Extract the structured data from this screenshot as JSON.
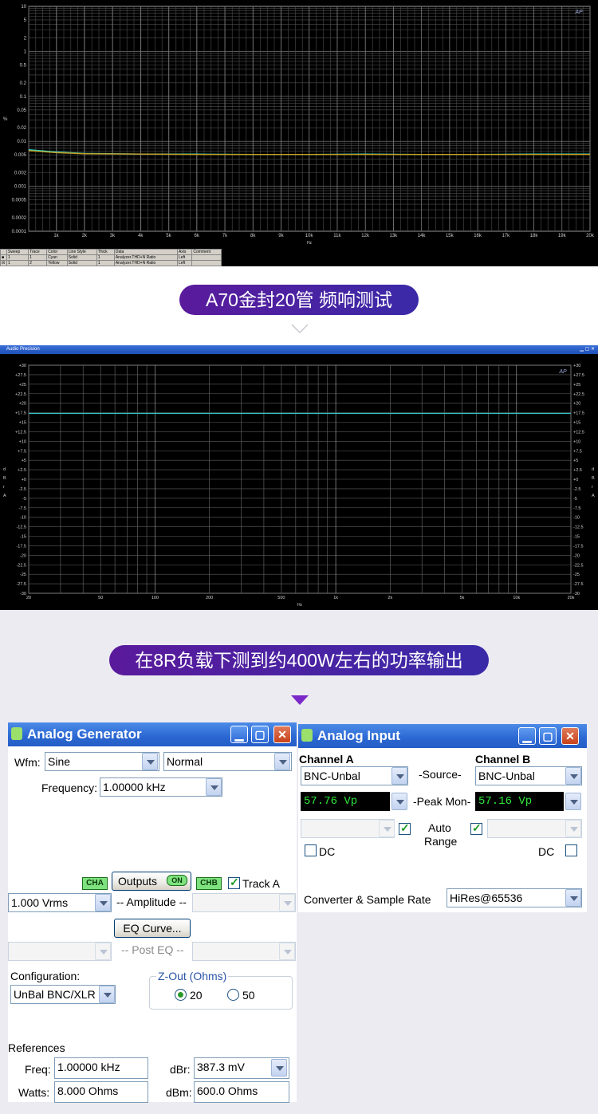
{
  "thd_chart": {
    "y_ticks": [
      "10",
      "5",
      "2",
      "1",
      "0.5",
      "0.2",
      "0.1",
      "0.05",
      "0.02",
      "0.01",
      "0.005",
      "0.002",
      "0.001",
      "0.0005",
      "0.0002",
      "0.0001"
    ],
    "x_ticks": [
      "1k",
      "2k",
      "3k",
      "4k",
      "5k",
      "6k",
      "7k",
      "8k",
      "9k",
      "10k",
      "11k",
      "12k",
      "13k",
      "14k",
      "15k",
      "16k",
      "17k",
      "18k",
      "19k",
      "20k"
    ],
    "ylabel": "%",
    "xlabel": "Hz",
    "logo": "AP",
    "table_headers": [
      "Sweep",
      "Trace",
      "Color",
      "Line Style",
      "Thick",
      "Data",
      "Axis",
      "Comment"
    ],
    "table_rows": [
      [
        "1",
        "1",
        "Cyan",
        "Solid",
        "1",
        "Analyzer.THD+N Ratio",
        "Left",
        ""
      ],
      [
        "1",
        "2",
        "Yellow",
        "Solid",
        "1",
        "Analyzer.THD+N Ratio",
        "Left",
        ""
      ]
    ]
  },
  "chart_data": [
    {
      "type": "line",
      "ylabel": "%",
      "xlabel": "Hz",
      "x": [
        20,
        1000,
        2000,
        4000,
        6000,
        8000,
        10000,
        12000,
        14000,
        16000,
        18000,
        20000
      ],
      "xlim": [
        20,
        20000
      ],
      "ylim": [
        0.0001,
        10
      ],
      "yscale": "log",
      "series": [
        {
          "name": "Cyan",
          "color": "#2fd0c0",
          "values": [
            0.0065,
            0.0058,
            0.0054,
            0.0052,
            0.0052,
            0.0051,
            0.0051,
            0.0052,
            0.0051,
            0.0051,
            0.0052,
            0.0052
          ]
        },
        {
          "name": "Yellow",
          "color": "#c8a020",
          "values": [
            0.0062,
            0.0056,
            0.0053,
            0.0052,
            0.0051,
            0.0051,
            0.0051,
            0.0051,
            0.0051,
            0.0051,
            0.0051,
            0.0051
          ]
        }
      ]
    },
    {
      "type": "line",
      "xlabel": "Hz",
      "ylabel": "dBrA",
      "x": [
        20,
        50,
        100,
        200,
        500,
        1000,
        2000,
        5000,
        10000,
        20000
      ],
      "xscale": "log",
      "xlim": [
        20,
        20000
      ],
      "ylim": [
        -30,
        30
      ],
      "series": [
        {
          "name": "Cyan",
          "color": "#2fc0c0",
          "values": [
            17.3,
            17.3,
            17.3,
            17.3,
            17.3,
            17.3,
            17.3,
            17.3,
            17.3,
            17.3
          ]
        }
      ]
    }
  ],
  "titles": {
    "t1": "A70金封20管  频响测试",
    "t2": "在8R负载下测到约400W左右的功率输出"
  },
  "fr_chart": {
    "window_title": "Audio Precision",
    "y_ticks": [
      "+30",
      "+27.5",
      "+25",
      "+22.5",
      "+20",
      "+17.5",
      "+15",
      "+12.5",
      "+10",
      "+7.5",
      "+5",
      "+2.5",
      "+0",
      "-2.5",
      "-5",
      "-7.5",
      "-10",
      "-12.5",
      "-15",
      "-17.5",
      "-20",
      "-22.5",
      "-25",
      "-27.5",
      "-30"
    ],
    "x_ticks": [
      "20",
      "50",
      "100",
      "200",
      "500",
      "1k",
      "2k",
      "5k",
      "10k",
      "20k"
    ],
    "ylabel_left": [
      "d",
      "B",
      "r",
      "A"
    ],
    "ylabel_right": [
      "d",
      "B",
      "r",
      "A"
    ],
    "xlabel": "Hz",
    "logo": "AP"
  },
  "generator": {
    "title": "Analog Generator",
    "wfm_label": "Wfm:",
    "wfm_value": "Sine",
    "wfm_mode": "Normal",
    "freq_label": "Frequency:",
    "freq_value": "1.00000 kHz",
    "cha": "CHA",
    "outputs_label": "Outputs",
    "outputs_state": "ON",
    "chb": "CHB",
    "track_label": "Track A",
    "amp_value": "1.000    Vrms",
    "amp_label": "-- Amplitude --",
    "eq_button": "EQ Curve...",
    "post_eq_label": "-- Post EQ --",
    "config_label": "Configuration:",
    "config_value": "UnBal BNC/XLR",
    "zout_label": "Z-Out (Ohms)",
    "zout_20": "20",
    "zout_50": "50",
    "references_label": "References",
    "ref_freq_label": "Freq:",
    "ref_freq_value": "1.00000 kHz",
    "ref_dbr_label": "dBr:",
    "ref_dbr_value": "387.3   mV",
    "ref_watts_label": "Watts:",
    "ref_watts_value": "8.000    Ohms",
    "ref_dbm_label": "dBm:",
    "ref_dbm_value": "600.0    Ohms"
  },
  "input": {
    "title": "Analog Input",
    "cha_label": "Channel A",
    "chb_label": "Channel B",
    "source_label": "-Source-",
    "cha_source": "BNC-Unbal",
    "chb_source": "BNC-Unbal",
    "peak_label": "-Peak Mon-",
    "cha_peak": "57.76   Vp",
    "chb_peak": "57.16   Vp",
    "auto_label": "Auto",
    "range_label": "Range",
    "dc_label": "DC",
    "converter_label": "Converter & Sample Rate",
    "converter_value": "HiRes@65536"
  }
}
